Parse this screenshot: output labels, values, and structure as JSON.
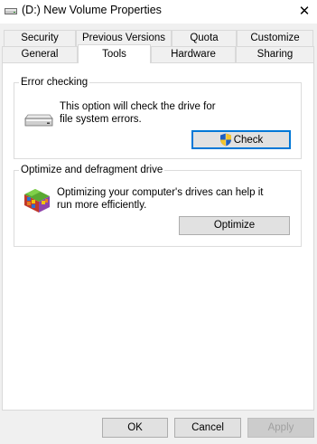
{
  "window": {
    "title": "(D:) New Volume Properties",
    "title_icon": "drive-icon",
    "close_glyph": "✕"
  },
  "tabs_top": [
    {
      "label": "Security"
    },
    {
      "label": "Previous Versions"
    },
    {
      "label": "Quota"
    },
    {
      "label": "Customize"
    }
  ],
  "tabs_bottom": [
    {
      "label": "General"
    },
    {
      "label": "Tools",
      "selected": true
    },
    {
      "label": "Hardware"
    },
    {
      "label": "Sharing"
    }
  ],
  "error_checking": {
    "title": "Error checking",
    "icon": "hard-drive-icon",
    "description": "This option will check the drive for file system errors.",
    "button_label": "Check",
    "button_icon": "uac-shield-icon"
  },
  "optimize": {
    "title": "Optimize and defragment drive",
    "icon": "defrag-icon",
    "description": "Optimizing your computer's drives can help it run more efficiently.",
    "button_label": "Optimize"
  },
  "footer": {
    "ok_label": "OK",
    "cancel_label": "Cancel",
    "apply_label": "Apply"
  },
  "colors": {
    "accent": "#0078d7",
    "window_bg": "#f0f0f0",
    "panel_bg": "#ffffff"
  }
}
